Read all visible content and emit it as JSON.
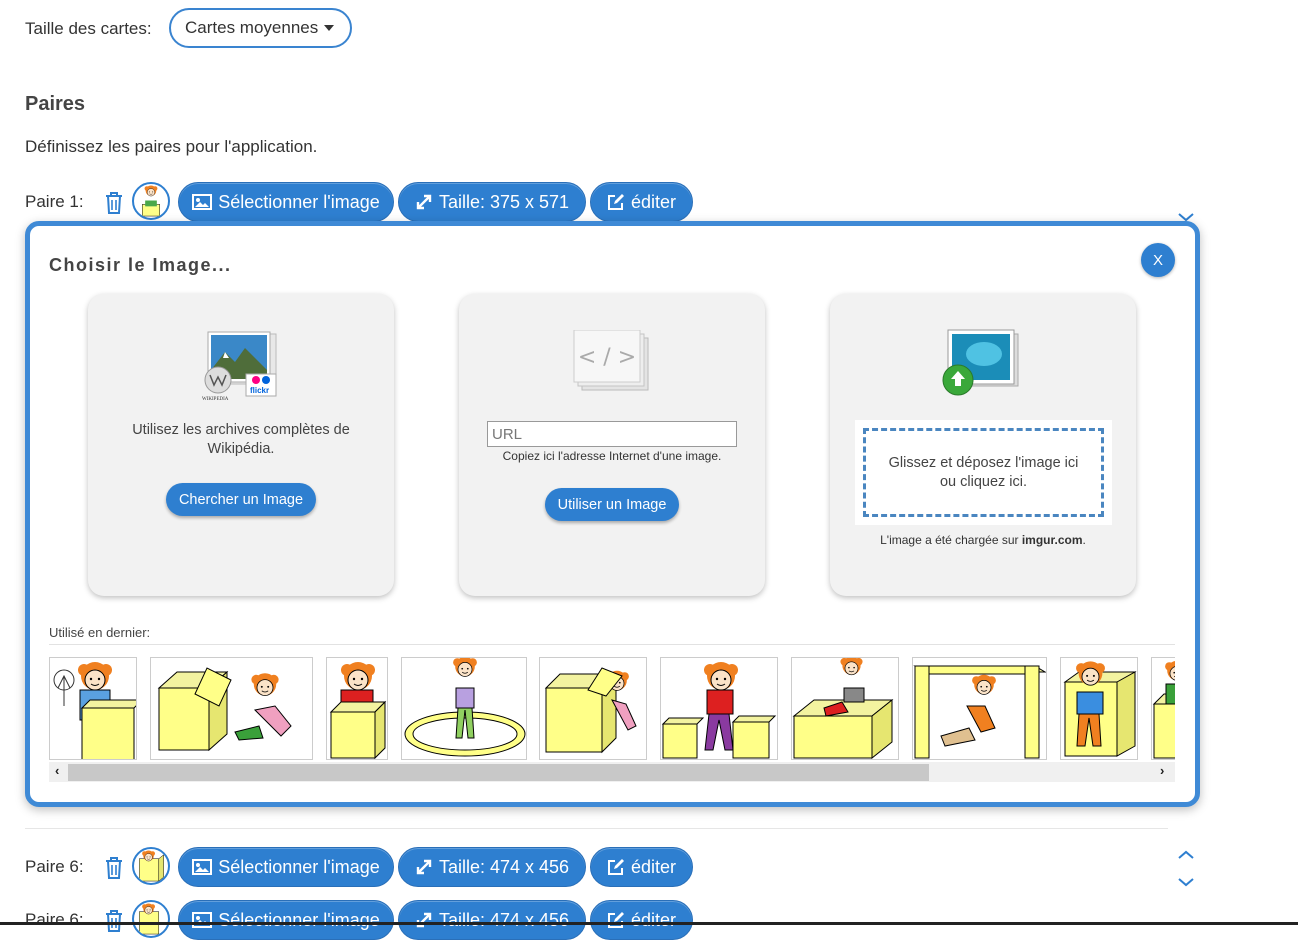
{
  "settings": {
    "card_size_label": "Taille des cartes:",
    "card_size_value": "Cartes moyennes"
  },
  "section": {
    "title": "Paires",
    "description": "Définissez les paires pour l'application."
  },
  "pairs": [
    {
      "label": "Paire 1:",
      "select_label": "Sélectionner l'image",
      "size_label": "Taille: 375 x 571",
      "edit_label": "éditer"
    },
    {
      "label": "Paire 6:",
      "select_label": "Sélectionner l'image",
      "size_label": "Taille: 474 x 456",
      "edit_label": "éditer"
    },
    {
      "label": "Paire 6:",
      "select_label": "Sélectionner l'image",
      "size_label": "Taille: 474 x 456",
      "edit_label": "éditer"
    }
  ],
  "modal": {
    "title": "Choisir le Image...",
    "close_label": "X",
    "wikipedia": {
      "text": "Utilisez les archives complètes de Wikipédia.",
      "button": "Chercher un Image",
      "icon_caption_left": "WIKIPEDIA",
      "icon_caption_right": "flickr"
    },
    "url": {
      "placeholder": "URL",
      "hint": "Copiez ici l'adresse Internet d'une image.",
      "button": "Utiliser un Image",
      "icon_glyph": "< / >"
    },
    "upload": {
      "dropzone_text": "Glissez et déposez l'image ici ou cliquez ici.",
      "note_prefix": "L'image a été chargée sur ",
      "note_site": "imgur.com",
      "note_suffix": "."
    },
    "recent_label": "Utilisé en dernier:",
    "scroll_left": "‹",
    "scroll_right": "›"
  },
  "icons": {
    "trash": "trash-icon",
    "image": "image-icon",
    "resize": "resize-icon",
    "edit": "edit-icon",
    "chevron_up": "chevron-up-icon",
    "chevron_down": "chevron-down-icon"
  },
  "colors": {
    "primary": "#2e7fd0",
    "modal_border": "#3f8ad6",
    "card_bg": "#f2f2f2",
    "box_yellow": "#ffff88",
    "hair_orange": "#f08020"
  }
}
